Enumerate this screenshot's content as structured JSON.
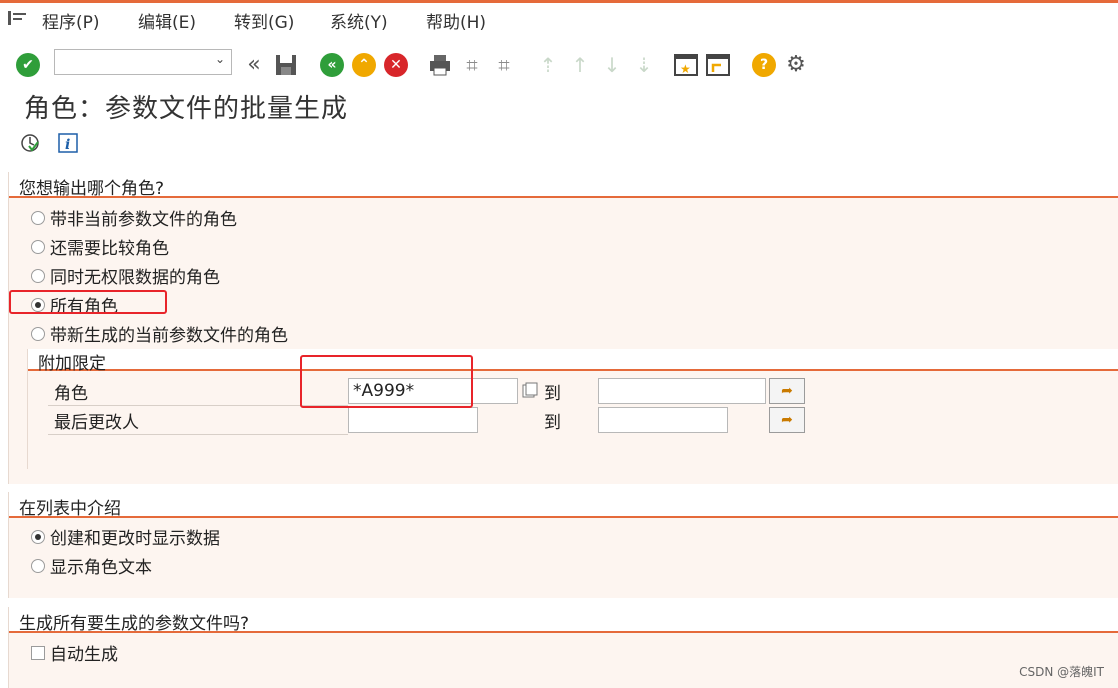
{
  "menu": {
    "items": [
      "程序(P)",
      "编辑(E)",
      "转到(G)",
      "系统(Y)",
      "帮助(H)"
    ]
  },
  "toolbar": {
    "command_value": "",
    "icons": [
      "enter-icon",
      "back-icon",
      "save-icon",
      "nav-back-icon",
      "exit-icon",
      "cancel-icon",
      "print-icon",
      "find-icon",
      "find-next-icon",
      "first-page-icon",
      "prev-page-icon",
      "next-page-icon",
      "last-page-icon",
      "new-session-icon",
      "shortcut-icon",
      "help-icon",
      "settings-icon"
    ]
  },
  "page": {
    "title": "角色：参数文件的批量生成"
  },
  "section1": {
    "title": "您想输出哪个角色?",
    "options": [
      {
        "label": "带非当前参数文件的角色",
        "selected": false
      },
      {
        "label": "还需要比较角色",
        "selected": false
      },
      {
        "label": "同时无权限数据的角色",
        "selected": false
      },
      {
        "label": "所有角色",
        "selected": true
      },
      {
        "label": "带新生成的当前参数文件的角色",
        "selected": false
      }
    ],
    "subsection": {
      "title": "附加限定",
      "rows": [
        {
          "label": "角色",
          "from": "*A999*",
          "to_label": "到",
          "to": ""
        },
        {
          "label": "最后更改人",
          "from": "",
          "to_label": "到",
          "to": ""
        }
      ]
    }
  },
  "section2": {
    "title": "在列表中介绍",
    "options": [
      {
        "label": "创建和更改时显示数据",
        "selected": true
      },
      {
        "label": "显示角色文本",
        "selected": false
      }
    ]
  },
  "section3": {
    "title": "生成所有要生成的参数文件吗?",
    "checkbox": {
      "label": "自动生成",
      "checked": false
    }
  },
  "watermark": "CSDN @落魄IT",
  "colors": {
    "accent": "#e56a3a",
    "highlight": "#e8242a",
    "ok": "#2f9e3a"
  }
}
